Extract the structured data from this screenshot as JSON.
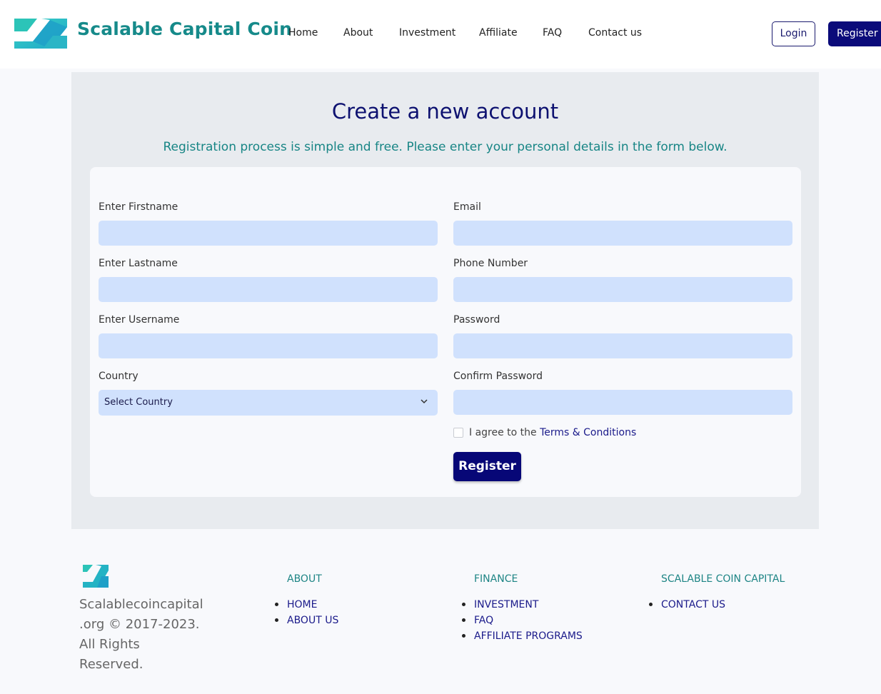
{
  "header": {
    "brand": "Scalable Capital Coin",
    "nav": [
      "Home",
      "About",
      "Investment",
      "Affiliate",
      "FAQ",
      "Contact us"
    ],
    "login_label": "Login",
    "register_label": "Register"
  },
  "main": {
    "title": "Create a new account",
    "subtitle": "Registration process is simple and free. Please enter your personal details in the form below.",
    "form": {
      "firstname_label": "Enter Firstname",
      "lastname_label": "Enter Lastname",
      "username_label": "Enter Username",
      "country_label": "Country",
      "country_value": "Select Country",
      "email_label": "Email",
      "phone_label": "Phone Number",
      "password_label": "Password",
      "confirm_label": "Confirm Password",
      "agree_prefix": "I agree to the",
      "terms_link": "Terms & Conditions",
      "submit_label": "Register"
    }
  },
  "footer": {
    "copyright": "Scalablecoincapital .org © 2017-2023. All Rights Reserved.",
    "columns": [
      {
        "title": "ABOUT",
        "links": [
          "HOME",
          "ABOUT US"
        ]
      },
      {
        "title": "FINANCE",
        "links": [
          "INVESTMENT",
          "FAQ",
          "AFFILIATE PROGRAMS"
        ]
      },
      {
        "title": "SCALABLE COIN CAPITAL",
        "links": [
          "CONTACT US"
        ]
      }
    ]
  },
  "colors": {
    "brand_teal": "#168a8a",
    "navy": "#0b0b7a",
    "input_bg": "#d0e1fd",
    "panel_bg": "#e8ebef"
  },
  "icons": {
    "logo": "logo-icon",
    "select_arrow": "chevron-down-icon"
  }
}
